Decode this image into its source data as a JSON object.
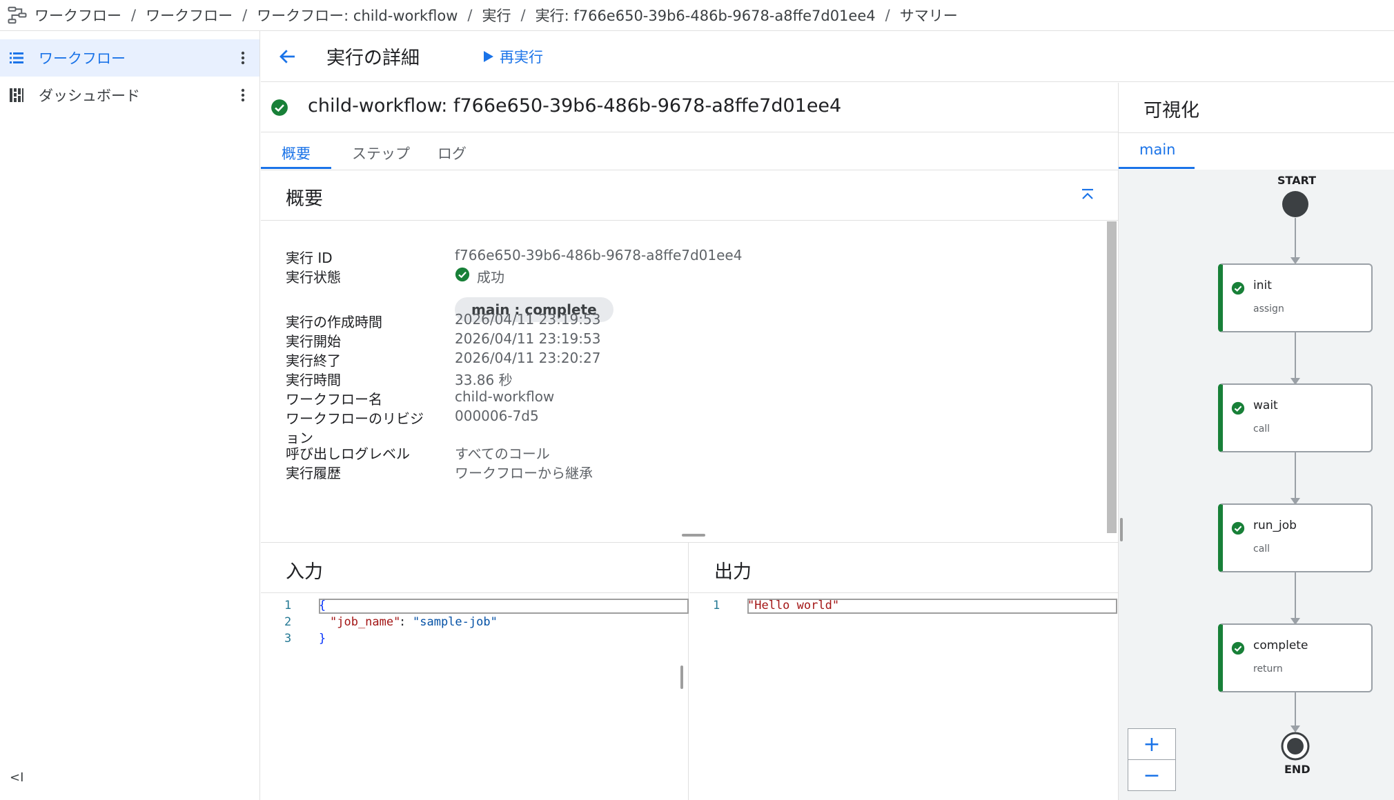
{
  "breadcrumb": {
    "items": [
      "ワークフロー",
      "ワークフロー",
      "ワークフロー: child-workflow",
      "実行",
      "実行: f766e650-39b6-486b-9678-a8ffe7d01ee4",
      "サマリー"
    ],
    "separator": "/"
  },
  "sidebar": {
    "items": [
      {
        "label": "ワークフロー",
        "icon": "list-icon",
        "active": true
      },
      {
        "label": "ダッシュボード",
        "icon": "dashboard-icon",
        "active": false
      }
    ],
    "collapse_label": "<I"
  },
  "toolbar": {
    "title": "実行の詳細",
    "rerun_label": "再実行"
  },
  "execution": {
    "title": "child-workflow: f766e650-39b6-486b-9678-a8ffe7d01ee4",
    "tabs": [
      "概要",
      "ステップ",
      "ログ"
    ],
    "active_tab": "概要"
  },
  "summary": {
    "title": "概要",
    "rows": {
      "exec_id": {
        "label": "実行 ID",
        "value": "f766e650-39b6-486b-9678-a8ffe7d01ee4"
      },
      "status": {
        "label": "実行状態",
        "value": "成功",
        "chip": "main : complete"
      },
      "created": {
        "label": "実行の作成時間",
        "value": "2026/04/11 23:19:53"
      },
      "start": {
        "label": "実行開始",
        "value": "2026/04/11 23:19:53"
      },
      "end": {
        "label": "実行終了",
        "value": "2026/04/11 23:20:27"
      },
      "duration": {
        "label": "実行時間",
        "value": "33.86 秒"
      },
      "workflow_name": {
        "label": "ワークフロー名",
        "value": "child-workflow"
      },
      "revision": {
        "label_line1": "ワークフローのリビジ",
        "label_line2": "ョン",
        "value": "000006-7d5"
      },
      "log_level": {
        "label": "呼び出しログレベル",
        "value": "すべてのコール"
      },
      "history": {
        "label": "実行履歴",
        "value": "ワークフローから継承"
      }
    }
  },
  "input": {
    "title": "入力",
    "line_numbers": [
      "1",
      "2",
      "3"
    ],
    "line1": "{",
    "key": "\"job_name\"",
    "colon": ": ",
    "val": "\"sample-job\"",
    "line3": "}"
  },
  "output": {
    "title": "出力",
    "line_numbers": [
      "1"
    ],
    "line1": "\"Hello world\""
  },
  "visualization": {
    "title": "可視化",
    "tab": "main",
    "start_label": "START",
    "end_label": "END",
    "nodes": [
      {
        "name": "init",
        "type": "assign"
      },
      {
        "name": "wait",
        "type": "call"
      },
      {
        "name": "run_job",
        "type": "call"
      },
      {
        "name": "complete",
        "type": "return"
      }
    ],
    "zoom_in": "+",
    "zoom_out": "−"
  },
  "colors": {
    "accent": "#1a73e8",
    "success": "#188038",
    "active_bg": "#e8f0fe"
  }
}
